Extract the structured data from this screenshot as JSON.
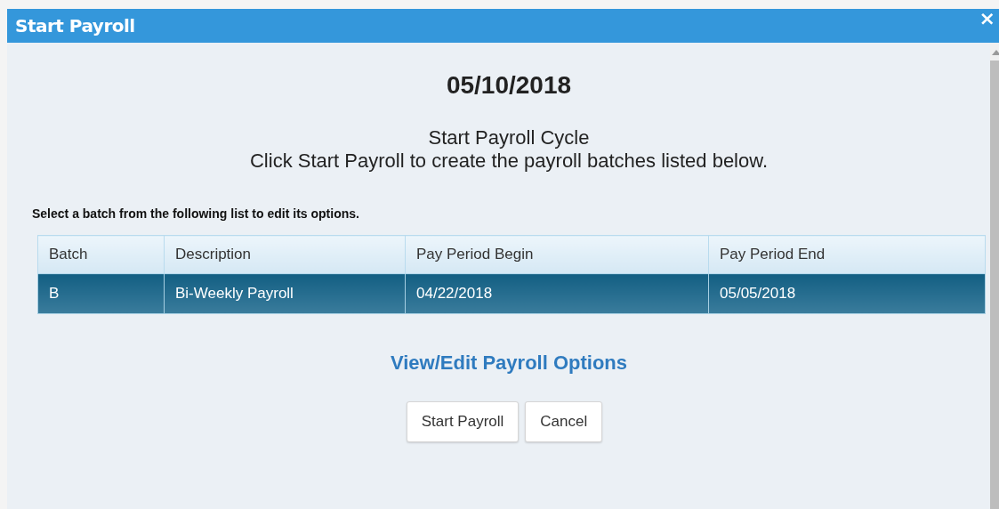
{
  "window": {
    "title": "Start Payroll",
    "close": "×"
  },
  "date": "05/10/2018",
  "intro": [
    "Start Payroll Cycle",
    "Click Start Payroll to create the payroll batches listed below."
  ],
  "instruction": "Select a batch from the following list to edit its options.",
  "table": {
    "columns": [
      "Batch",
      "Description",
      "Pay Period Begin",
      "Pay Period End"
    ],
    "rows": [
      {
        "cells": [
          "B",
          "Bi-Weekly Payroll",
          "04/22/2018",
          "05/05/2018"
        ],
        "selected": true
      }
    ]
  },
  "options_link": "View/Edit Payroll Options",
  "buttons": [
    "Start Payroll",
    "Cancel"
  ]
}
